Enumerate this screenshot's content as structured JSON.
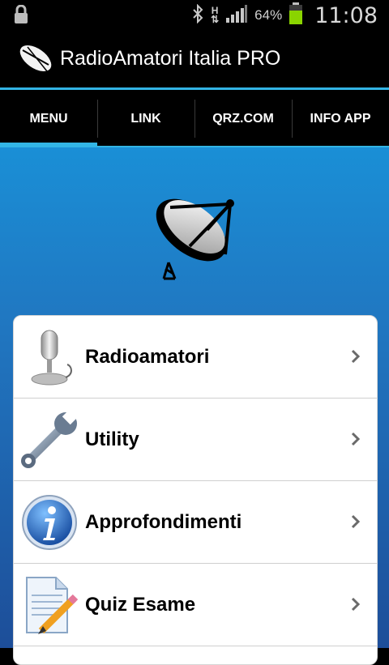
{
  "status_bar": {
    "battery_percent": "64%",
    "time": "11:08",
    "network_type": "H",
    "icons": [
      "lock-icon",
      "bluetooth-icon",
      "network-h-icon",
      "signal-icon",
      "battery-icon"
    ]
  },
  "app": {
    "title": "RadioAmatori Italia PRO",
    "accent_color": "#33b5e5"
  },
  "tabs": [
    {
      "label": "MENU",
      "active": true
    },
    {
      "label": "LINK",
      "active": false
    },
    {
      "label": "QRZ.COM",
      "active": false
    },
    {
      "label": "INFO APP",
      "active": false
    }
  ],
  "menu": {
    "items": [
      {
        "label": "Radioamatori",
        "icon": "microphone-icon"
      },
      {
        "label": "Utility",
        "icon": "wrench-icon"
      },
      {
        "label": "Approfondimenti",
        "icon": "info-icon"
      },
      {
        "label": "Quiz Esame",
        "icon": "document-pencil-icon"
      }
    ]
  }
}
